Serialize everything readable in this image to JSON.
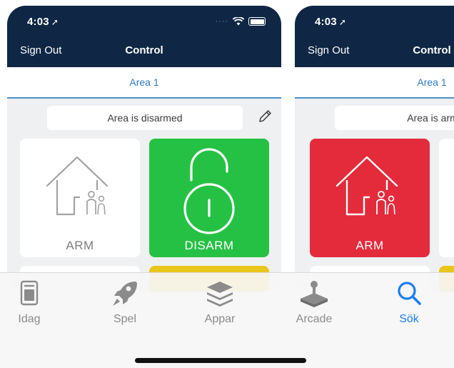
{
  "phones": [
    {
      "status_time": "4:03",
      "nav": {
        "left": "Sign Out",
        "title": "Control"
      },
      "area_tab": "Area 1",
      "status_text": "Area is disarmed",
      "tiles": [
        {
          "label": "ARM",
          "color": "#ffffff"
        },
        {
          "label": "DISARM",
          "color": "#25c144"
        }
      ]
    },
    {
      "status_time": "4:03",
      "nav": {
        "left": "Sign Out",
        "title": "Control"
      },
      "area_tab": "Area 1",
      "status_text": "Area is arm",
      "tiles": [
        {
          "label": "ARM",
          "color": "#e32b3b"
        }
      ]
    }
  ],
  "tabbar": {
    "items": [
      {
        "label": "Idag",
        "icon": "today-icon",
        "active": false
      },
      {
        "label": "Spel",
        "icon": "rocket-icon",
        "active": false
      },
      {
        "label": "Appar",
        "icon": "layers-icon",
        "active": false
      },
      {
        "label": "Arcade",
        "icon": "joystick-icon",
        "active": false
      },
      {
        "label": "Sök",
        "icon": "search-icon",
        "active": true
      }
    ]
  },
  "colors": {
    "navbar": "#0f2745",
    "accent_blue": "#2f79c1",
    "disarm_green": "#25c144",
    "arm_red": "#e32b3b",
    "warning_yellow": "#e8c61a",
    "tab_active": "#1a7ef2"
  }
}
